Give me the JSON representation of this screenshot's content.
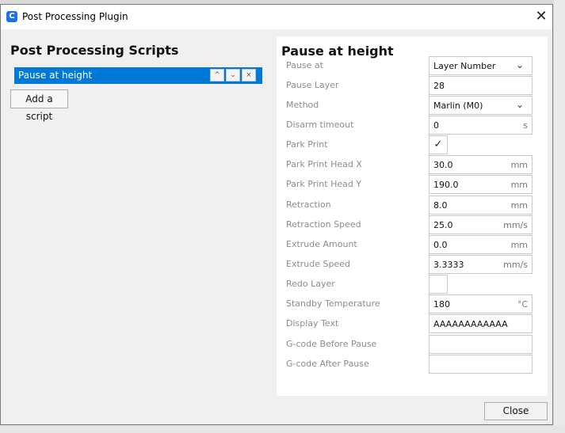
{
  "window": {
    "title": "Post Processing Plugin",
    "app_icon": "C",
    "close_glyph": "✕"
  },
  "left": {
    "heading": "Post Processing Scripts",
    "scripts": [
      {
        "label": "Pause at height"
      }
    ],
    "buttons": {
      "move_up": "^",
      "move_down": "⌄",
      "remove": "×"
    },
    "add_script_label": "Add a script"
  },
  "settings": {
    "title": "Pause at height",
    "rows": [
      {
        "label": "Pause at",
        "value": "Layer Number",
        "unit": "",
        "kind": "dropdown"
      },
      {
        "label": "Pause Layer",
        "value": "28",
        "unit": "",
        "kind": "text"
      },
      {
        "label": "Method",
        "value": "Marlin (M0)",
        "unit": "",
        "kind": "dropdown"
      },
      {
        "label": "Disarm timeout",
        "value": "0",
        "unit": "s",
        "kind": "text"
      },
      {
        "label": "Park Print",
        "value": "✓",
        "unit": "",
        "kind": "checkbox",
        "checked": true
      },
      {
        "label": "Park Print Head X",
        "value": "30.0",
        "unit": "mm",
        "kind": "text"
      },
      {
        "label": "Park Print Head Y",
        "value": "190.0",
        "unit": "mm",
        "kind": "text"
      },
      {
        "label": "Retraction",
        "value": "8.0",
        "unit": "mm",
        "kind": "text"
      },
      {
        "label": "Retraction Speed",
        "value": "25.0",
        "unit": "mm/s",
        "kind": "text"
      },
      {
        "label": "Extrude Amount",
        "value": "0.0",
        "unit": "mm",
        "kind": "text"
      },
      {
        "label": "Extrude Speed",
        "value": "3.3333",
        "unit": "mm/s",
        "kind": "text"
      },
      {
        "label": "Redo Layer",
        "value": "",
        "unit": "",
        "kind": "checkbox",
        "checked": false
      },
      {
        "label": "Standby Temperature",
        "value": "180",
        "unit": "°C",
        "kind": "text"
      },
      {
        "label": "Display Text",
        "value": "AAAAAAAAAAAA",
        "unit": "",
        "kind": "text"
      },
      {
        "label": "G-code Before Pause",
        "value": "",
        "unit": "",
        "kind": "text"
      },
      {
        "label": "G-code After Pause",
        "value": "",
        "unit": "",
        "kind": "text"
      }
    ]
  },
  "footer": {
    "close_label": "Close"
  },
  "colors": {
    "selection": "#0078d7",
    "label_gray": "#8c8c8c"
  }
}
